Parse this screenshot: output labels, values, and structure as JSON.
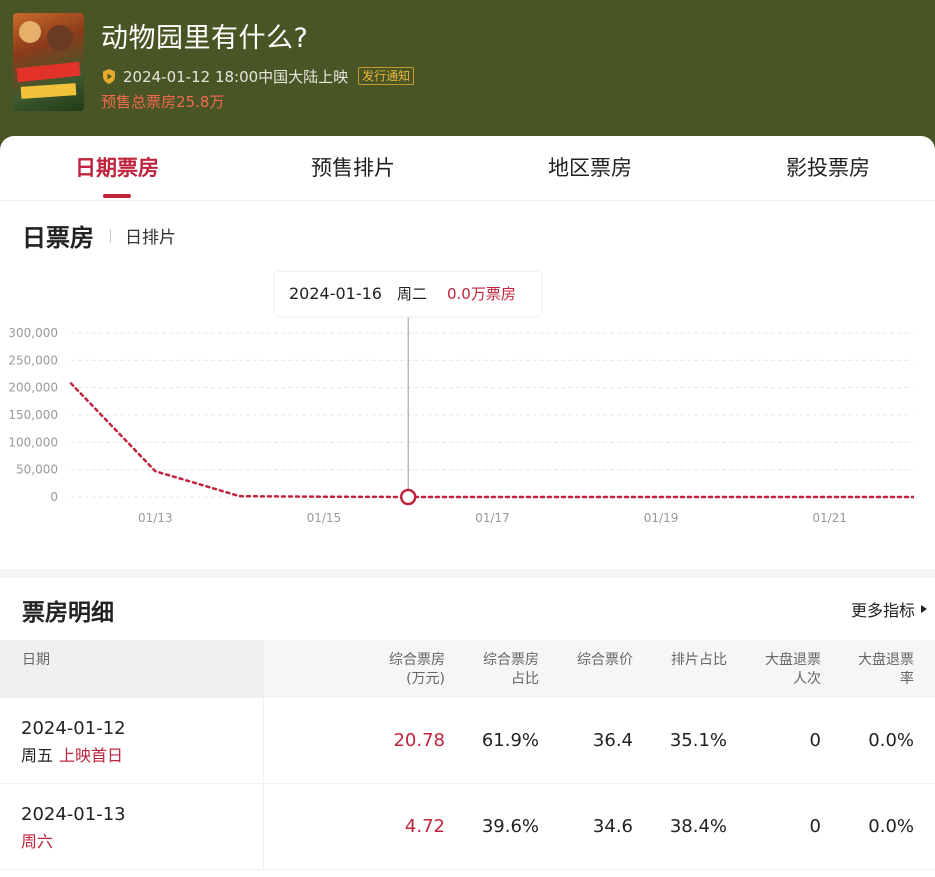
{
  "header": {
    "title": "动物园里有什么?",
    "release_text": "2024-01-12 18:00中国大陆上映",
    "notice_badge": "发行通知",
    "presale_text": "预售总票房25.8万",
    "icon": "shield-icon"
  },
  "tabs": [
    {
      "label": "日期票房",
      "active": true
    },
    {
      "label": "预售排片",
      "active": false
    },
    {
      "label": "地区票房",
      "active": false
    },
    {
      "label": "影投票房",
      "active": false
    }
  ],
  "section": {
    "title": "日票房",
    "subtab": "日排片"
  },
  "chart_data": {
    "type": "line",
    "title": "",
    "y_ticks": [
      "300,000",
      "250,000",
      "200,000",
      "150,000",
      "100,000",
      "50,000",
      "0"
    ],
    "ylim": [
      0,
      300000
    ],
    "x_ticks": [
      "01/13",
      "01/15",
      "01/17",
      "01/19",
      "01/21"
    ],
    "x": [
      "01/12",
      "01/13",
      "01/14",
      "01/15",
      "01/16",
      "01/17",
      "01/18",
      "01/19",
      "01/20",
      "01/21",
      "01/22"
    ],
    "values": [
      207800,
      47200,
      1500,
      500,
      0,
      0,
      0,
      0,
      0,
      0,
      0
    ],
    "grid": true,
    "line_color": "#c0243c",
    "line_style": "dotted",
    "tooltip": {
      "date": "2024-01-16",
      "weekday": "周二",
      "value": "0.0万票房",
      "index": 4
    }
  },
  "detail": {
    "title": "票房明细",
    "more_label": "更多指标",
    "columns": [
      {
        "line1": "日期",
        "line2": ""
      },
      {
        "line1": "综合票房",
        "line2": "(万元)"
      },
      {
        "line1": "综合票房",
        "line2": "占比"
      },
      {
        "line1": "综合票价",
        "line2": ""
      },
      {
        "line1": "排片占比",
        "line2": ""
      },
      {
        "line1": "大盘退票",
        "line2": "人次"
      },
      {
        "line1": "大盘退票",
        "line2": "率"
      }
    ],
    "rows": [
      {
        "date": "2024-01-12",
        "weekday": "周五",
        "weekday_red": false,
        "tag": "上映首日",
        "box": "20.78",
        "share": "61.9%",
        "price": "36.4",
        "sched": "35.1%",
        "refund": "0",
        "refund_rate": "0.0%"
      },
      {
        "date": "2024-01-13",
        "weekday": "周六",
        "weekday_red": true,
        "tag": "",
        "box": "4.72",
        "share": "39.6%",
        "price": "34.6",
        "sched": "38.4%",
        "refund": "0",
        "refund_rate": "0.0%"
      }
    ]
  },
  "colors": {
    "header_bg": "#4a5526",
    "accent": "#c0243c",
    "badge": "#e9b63a",
    "presale": "#f06a4e"
  }
}
